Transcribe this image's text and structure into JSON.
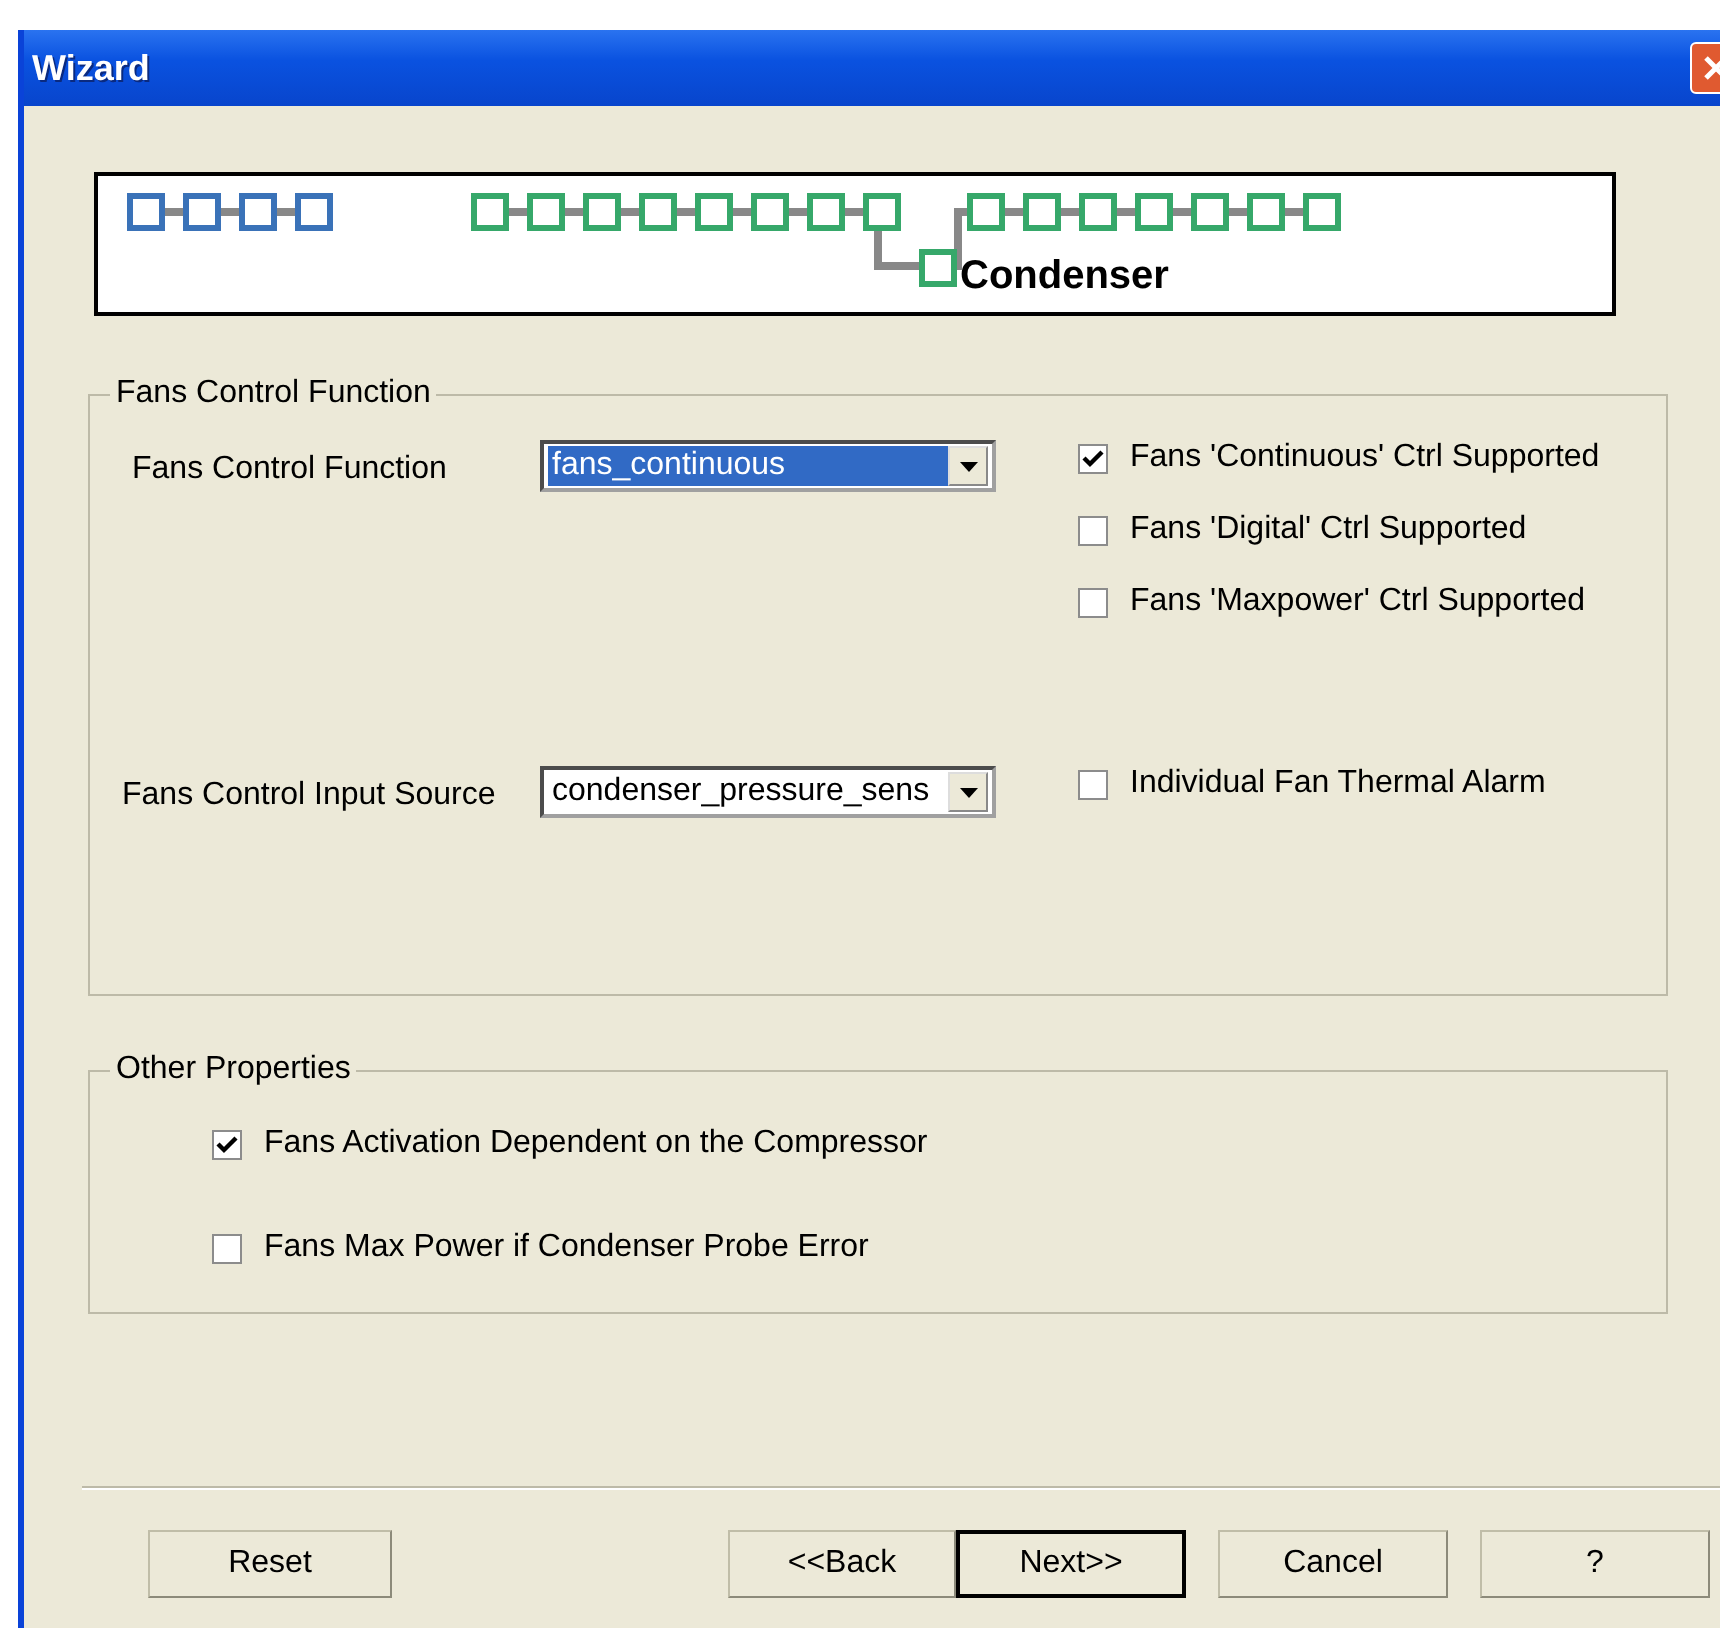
{
  "window": {
    "title": "Wizard"
  },
  "banner": {
    "step_label": "Condenser"
  },
  "fans_group": {
    "title": "Fans Control Function",
    "function": {
      "label": "Fans Control Function",
      "value": "fans_continuous",
      "highlighted": true
    },
    "support_checkboxes": [
      {
        "label": "Fans 'Continuous' Ctrl Supported",
        "checked": true
      },
      {
        "label": "Fans 'Digital' Ctrl Supported",
        "checked": false
      },
      {
        "label": "Fans 'Maxpower' Ctrl Supported",
        "checked": false
      }
    ],
    "input_source": {
      "label": "Fans Control Input Source",
      "value": "condenser_pressure_sens",
      "highlighted": false
    },
    "thermal_alarm": {
      "label": "Individual Fan Thermal Alarm",
      "checked": false
    }
  },
  "other_group": {
    "title": "Other Properties",
    "checkboxes": [
      {
        "label": "Fans Activation Dependent on the Compressor",
        "checked": true
      },
      {
        "label": "Fans Max Power if Condenser Probe Error",
        "checked": false
      }
    ]
  },
  "buttons": [
    {
      "label": "Reset",
      "default": false
    },
    {
      "label": "<<Back",
      "default": false
    },
    {
      "label": "Next>>",
      "default": true
    },
    {
      "label": "Cancel",
      "default": false
    },
    {
      "label": "?",
      "default": false
    }
  ]
}
